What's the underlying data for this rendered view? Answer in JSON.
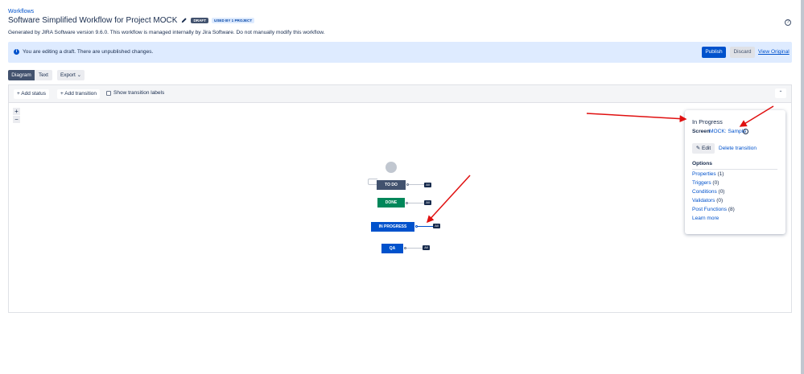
{
  "header": {
    "breadcrumb": "Workflows",
    "title": "Software Simplified Workflow for Project MOCK",
    "badge_draft": "DRAFT",
    "badge_used": "USED BY 1 PROJECT",
    "description": "Generated by JIRA Software version 9.6.0. This workflow is managed internally by Jira Software. Do not manually modify this workflow."
  },
  "banner": {
    "text": "You are editing a draft. There are unpublished changes.",
    "publish": "Publish",
    "discard": "Discard",
    "view_original": "View Original"
  },
  "view_tabs": [
    {
      "label": "Diagram",
      "active": true
    },
    {
      "label": "Text",
      "active": false
    }
  ],
  "export_label": "Export",
  "toolbar": {
    "add_status": "Add status",
    "add_transition": "Add transition",
    "show_labels": "Show transition labels",
    "show_labels_checked": false
  },
  "zoom": {
    "in": "+",
    "out": "−"
  },
  "diagram": {
    "nodes": [
      {
        "label": "TO DO",
        "color": "#42526e",
        "all": "All"
      },
      {
        "label": "DONE",
        "color": "#00875a",
        "all": "All"
      },
      {
        "label": "IN PROGRESS",
        "color": "#0052cc",
        "all": "All",
        "selected": true
      },
      {
        "label": "QA",
        "color": "#0052cc",
        "all": "All"
      }
    ]
  },
  "panel": {
    "title": "In Progress",
    "screen_label": "Screen",
    "screen_link": "MOCK: Sample",
    "edit": "Edit",
    "delete": "Delete transition",
    "options_heading": "Options",
    "options": [
      {
        "label": "Properties",
        "count": "(1)"
      },
      {
        "label": "Triggers",
        "count": "(0)"
      },
      {
        "label": "Conditions",
        "count": "(0)"
      },
      {
        "label": "Validators",
        "count": "(0)"
      },
      {
        "label": "Post Functions",
        "count": "(8)"
      }
    ],
    "learn_more": "Learn more"
  },
  "colors": {
    "accent": "#0052cc",
    "annotation_arrow": "#e01010"
  }
}
